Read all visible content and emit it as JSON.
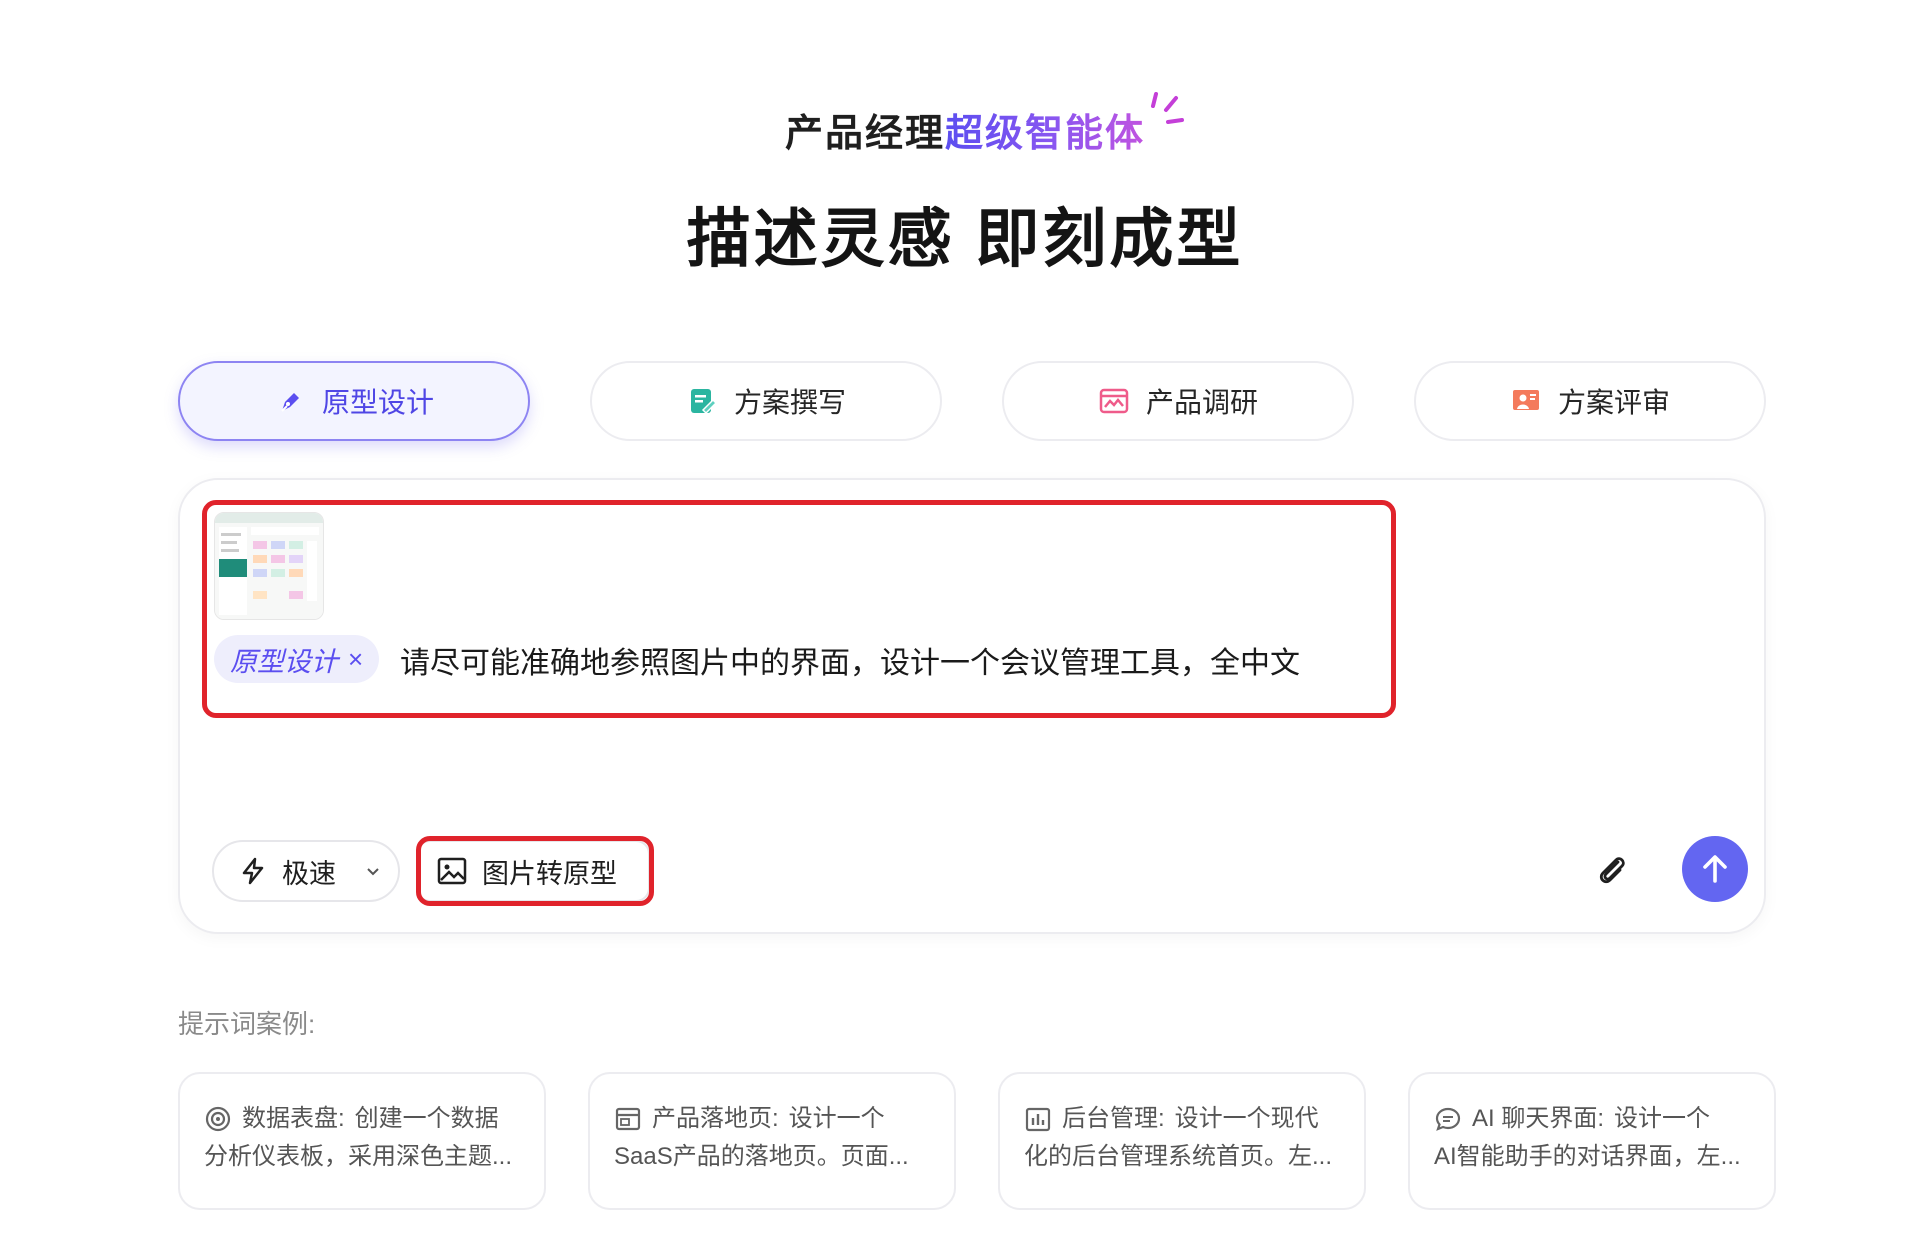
{
  "header": {
    "subtitle_plain": "产品经理",
    "subtitle_highlight": "超级智能体",
    "title": "描述灵感 即刻成型"
  },
  "tabs": [
    {
      "label": "原型设计",
      "icon": "pen-icon",
      "active": true
    },
    {
      "label": "方案撰写",
      "icon": "doc-edit-icon",
      "active": false
    },
    {
      "label": "产品调研",
      "icon": "chart-window-icon",
      "active": false
    },
    {
      "label": "方案评审",
      "icon": "presentation-icon",
      "active": false
    }
  ],
  "composer": {
    "chip_label": "原型设计",
    "chip_close": "×",
    "prompt": "请尽可能准确地参照图片中的界面，设计一个会议管理工具，全中文",
    "mode_label": "极速",
    "image_to_prototype_label": "图片转原型"
  },
  "examples": {
    "label": "提示词案例:",
    "cards": [
      {
        "title": "数据表盘:",
        "line1_rest": "创建一个数据",
        "line2": "分析仪表板，采用深色主题...",
        "icon": "gauge-icon"
      },
      {
        "title": "产品落地页:",
        "line1_rest": "设计一个",
        "line2": "SaaS产品的落地页。页面...",
        "icon": "browser-window-icon"
      },
      {
        "title": "后台管理:",
        "line1_rest": "设计一个现代",
        "line2": "化的后台管理系统首页。左...",
        "icon": "bar-chart-icon"
      },
      {
        "title": "AI 聊天界面:",
        "line1_rest": "设计一个",
        "line2": "AI智能助手的对话界面，左...",
        "icon": "chat-bubble-icon"
      }
    ]
  },
  "colors": {
    "accent": "#6366f1",
    "highlight_red": "#e0232b"
  }
}
